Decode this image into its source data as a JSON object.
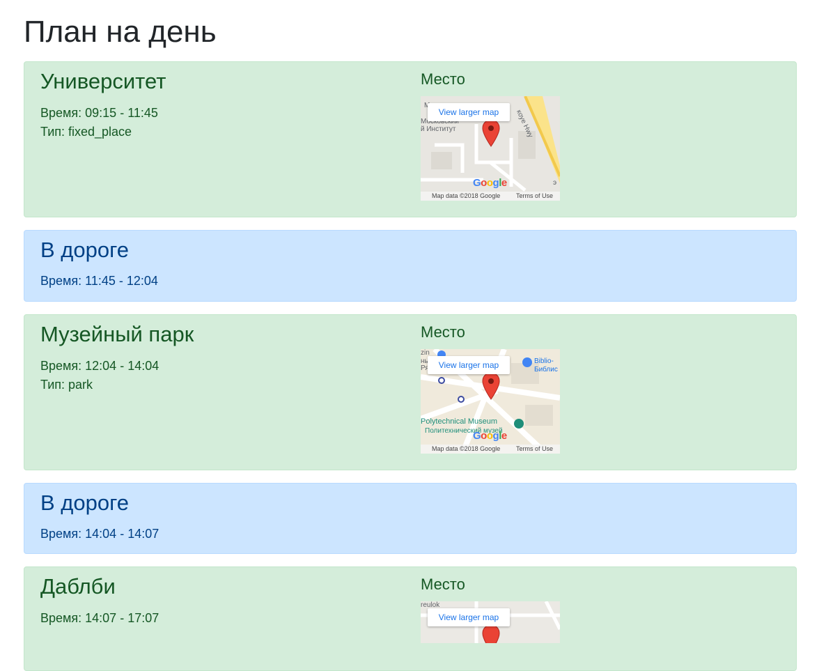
{
  "page": {
    "title": "План на день"
  },
  "cards": [
    {
      "title": "Университет",
      "time": "Время: 09:15 - 11:45",
      "type": "Тип: fixed_place",
      "place_label": "Место",
      "map": {
        "view_larger": "View larger map",
        "google": "Google",
        "map_data": "Map data ©2018 Google",
        "terms": "Terms of Use",
        "labels": [
          "Моско",
          "Московский",
          "й Институт",
          "коуе Hwy",
          "э"
        ]
      }
    },
    {
      "title": "В дороге",
      "time": "Время: 11:45 - 12:04"
    },
    {
      "title": "Музейный парк",
      "time": "Время: 12:04 - 14:04",
      "type": "Тип: park",
      "place_label": "Место",
      "map": {
        "view_larger": "View larger map",
        "google": "Google",
        "map_data": "Map data ©2018 Google",
        "terms": "Terms of Use",
        "labels": [
          "zin",
          "ны",
          "Ря",
          "Biblio-",
          "Библис",
          "Polytechnical Museum",
          "Политехнический музей"
        ]
      }
    },
    {
      "title": "В дороге",
      "time": "Время: 14:04 - 14:07"
    },
    {
      "title": "Даблби",
      "time": "Время: 14:07 - 17:07",
      "place_label": "Место",
      "map": {
        "view_larger": "View larger map",
        "labels": [
          "reulok"
        ]
      }
    }
  ]
}
